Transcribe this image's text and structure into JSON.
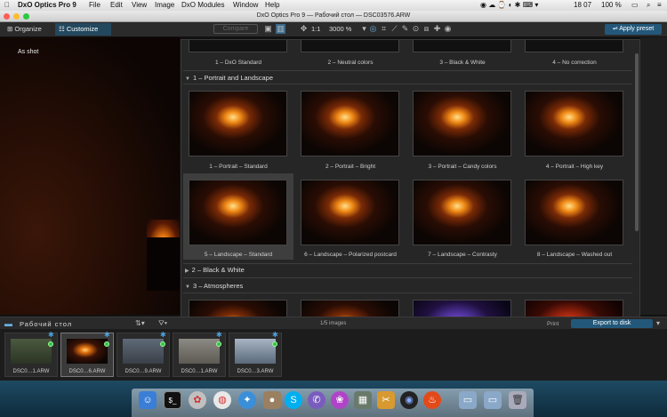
{
  "menubar": {
    "app": "DxO Optics Pro 9",
    "items": [
      "File",
      "Edit",
      "View",
      "Image",
      "DxO Modules",
      "Window",
      "Help"
    ],
    "clock": "18 07",
    "battery": "100 %"
  },
  "window": {
    "title": "DxO Optics Pro 9 — Рабочий стол — DSC03576.ARW"
  },
  "toolbar": {
    "organize": "Organize",
    "customize": "Customize",
    "compare": "Compare",
    "zoom_ratio": "1:1",
    "zoom_percent": "3000 %",
    "apply_preset": "Apply preset"
  },
  "viewer": {
    "label": "As shot"
  },
  "presets": {
    "top_row": [
      "1 – DxO Standard",
      "2 – Neutral colors",
      "3 – Black & White",
      "4 – No correction"
    ],
    "sections": [
      {
        "title": "1 – Portrait and Landscape",
        "items": [
          "1 – Portrait – Standard",
          "2 – Portrait – Bright",
          "3 – Portrait – Candy colors",
          "4 – Portrait – High key",
          "5 – Landscape – Standard",
          "6 – Landscape – Polarized postcard",
          "7 – Landscape – Contrasty",
          "8 – Landscape – Washed out"
        ]
      },
      {
        "title": "2 – Black & White"
      },
      {
        "title": "3 – Atmospheres"
      }
    ]
  },
  "browser": {
    "folder": "Рабочий стол",
    "count": "1/5 images",
    "print": "Print",
    "export": "Export to disk",
    "files": [
      "DSC0…1.ARW",
      "DSC0…6.ARW",
      "DSC0…9.ARW",
      "DSC0…1.ARW",
      "DSC0…3.ARW"
    ]
  },
  "colors": {
    "accent": "#23587a",
    "selected_tab": "#23485e",
    "badge_green": "#3cc04a"
  }
}
